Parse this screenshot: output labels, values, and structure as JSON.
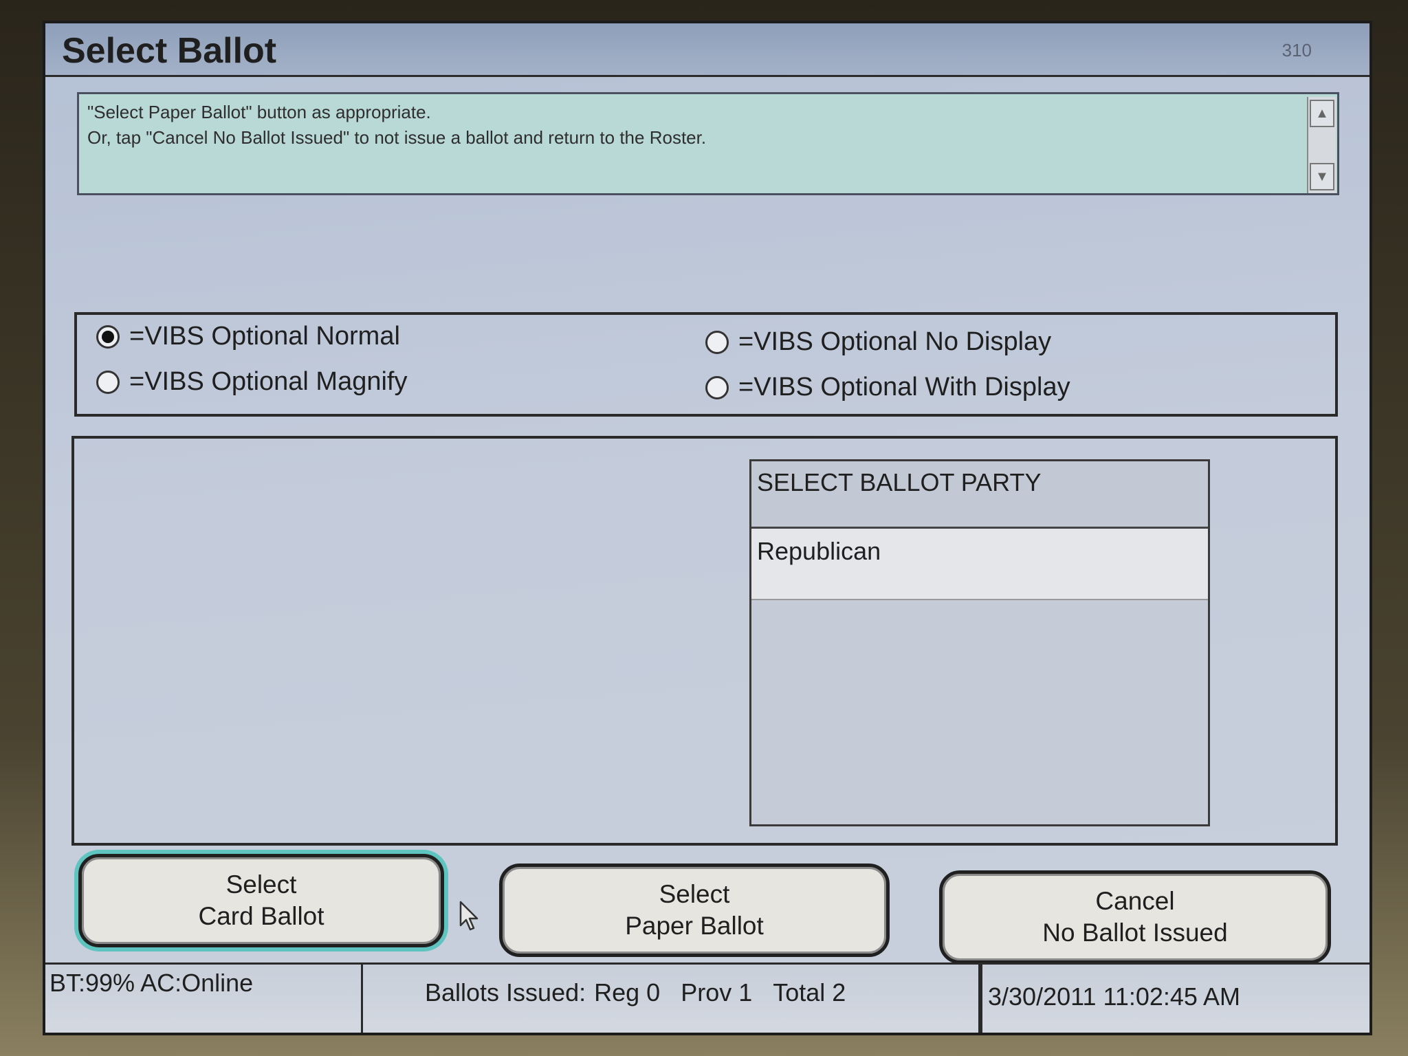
{
  "header": {
    "title": "Select Ballot",
    "screen_number": "310"
  },
  "instructions": {
    "line1": "\"Select Paper Ballot\" button as appropriate.",
    "line2": "Or, tap \"Cancel No Ballot Issued\" to not issue a ballot and return to the Roster."
  },
  "vibs_options": [
    {
      "label": "=VIBS Optional Normal",
      "selected": true
    },
    {
      "label": "=VIBS Optional Magnify",
      "selected": false
    },
    {
      "label": "=VIBS Optional No Display",
      "selected": false
    },
    {
      "label": "=VIBS Optional With Display",
      "selected": false
    }
  ],
  "party_list": {
    "header": "SELECT BALLOT PARTY",
    "items": [
      "Republican"
    ]
  },
  "buttons": {
    "card_ballot": {
      "line1": "Select",
      "line2": "Card Ballot"
    },
    "paper_ballot": {
      "line1": "Select",
      "line2": "Paper Ballot"
    },
    "cancel": {
      "line1": "Cancel",
      "line2": "No Ballot Issued"
    }
  },
  "status": {
    "battery": "BT:99% AC:Online",
    "ballots_label": "Ballots Issued:",
    "reg": "Reg 0",
    "prov": "Prov 1",
    "total": "Total 2",
    "datetime": "3/30/2011 11:02:45 AM"
  },
  "colors": {
    "screen_bg": "#c4ccdb",
    "instructions_bg": "#b9d9d6",
    "selected_button_glow": "#5fc4c0"
  }
}
